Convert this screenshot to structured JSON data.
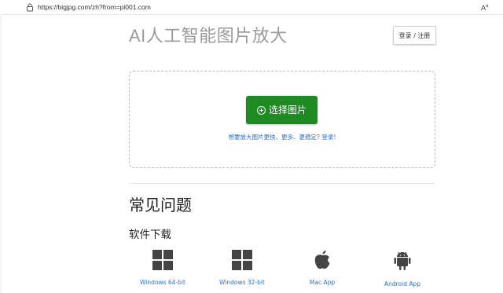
{
  "browser": {
    "url": "https://bigjpg.com/zh?from=pi001.com",
    "reader_label": "A",
    "reader_sup": "a"
  },
  "header": {
    "title": "AI人工智能图片放大",
    "login_label": "登录 / 注册"
  },
  "upload": {
    "select_label": "选择图片",
    "hint": "想要放大图片更快、更多、更稳定? 登录!"
  },
  "faq": {
    "title": "常见问题",
    "download_title": "软件下载"
  },
  "apps": [
    {
      "label": "Windows 64-bit",
      "icon": "windows-icon"
    },
    {
      "label": "Windows 32-bit",
      "icon": "windows-icon"
    },
    {
      "label": "Mac App",
      "icon": "apple-icon"
    },
    {
      "label": "Android App",
      "icon": "android-icon"
    }
  ],
  "colors": {
    "primary_button": "#1e8a22",
    "link": "#2a6fd6",
    "title_gray": "#9a9a9a"
  }
}
